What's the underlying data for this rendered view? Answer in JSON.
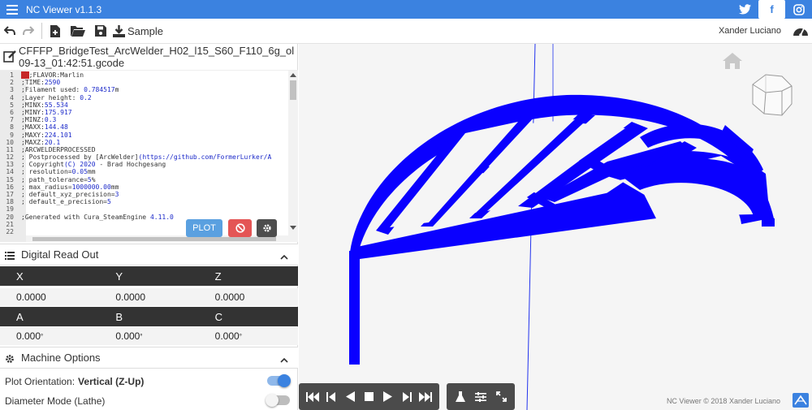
{
  "app": {
    "title": "NC Viewer  v1.1.3"
  },
  "social": {
    "twitter": "twitter-icon",
    "facebook": "facebook-icon",
    "instagram": "instagram-icon"
  },
  "toolbar": {
    "sample_label": "Sample",
    "user_name": "Xander Luciano"
  },
  "file": {
    "name_line1": "CFFFP_BridgeTest_ArcWelder_H02_l15_S60_F110_6g_ol",
    "name_line2": "09-13_01:42:51.gcode"
  },
  "editor": {
    "lines": [
      {
        "n": "1",
        "pre": "",
        "cursor": "  ",
        "text": ";FLAVOR:Marlin",
        "num": "",
        "post": ""
      },
      {
        "n": "2",
        "pre": ";TIME:",
        "num": "2590",
        "post": ""
      },
      {
        "n": "3",
        "pre": ";Filament used: ",
        "num": "0.784517",
        "post": "m"
      },
      {
        "n": "4",
        "pre": ";Layer height: ",
        "num": "0.2",
        "post": ""
      },
      {
        "n": "5",
        "pre": ";MINX:",
        "num": "55.534",
        "post": ""
      },
      {
        "n": "6",
        "pre": ";MINY:",
        "num": "175.917",
        "post": ""
      },
      {
        "n": "7",
        "pre": ";MINZ:",
        "num": "0.3",
        "post": ""
      },
      {
        "n": "8",
        "pre": ";MAXX:",
        "num": "144.48",
        "post": ""
      },
      {
        "n": "9",
        "pre": ";MAXY:",
        "num": "224.101",
        "post": ""
      },
      {
        "n": "10",
        "pre": ";MAXZ:",
        "num": "20.1",
        "post": ""
      },
      {
        "n": "11",
        "pre": ";ARCWELDERPROCESSED",
        "num": "",
        "post": ""
      },
      {
        "n": "12",
        "pre": "; Postprocessed by [ArcWelder]",
        "num": "(https://github.com/FormerLurker/A",
        "post": ""
      },
      {
        "n": "13",
        "pre": "; Copyright",
        "num": "(C) 2020",
        "post": " - Brad Hochgesang"
      },
      {
        "n": "14",
        "pre": "; resolution=",
        "num": "0.05",
        "post": "mm"
      },
      {
        "n": "15",
        "pre": "; path_tolerance=",
        "num": "5",
        "post": "%"
      },
      {
        "n": "16",
        "pre": "; max_radius=",
        "num": "1000000.00",
        "post": "mm"
      },
      {
        "n": "17",
        "pre": "; default_xyz_precision=",
        "num": "3",
        "post": ""
      },
      {
        "n": "18",
        "pre": "; default_e_precision=",
        "num": "5",
        "post": ""
      },
      {
        "n": "19",
        "pre": "",
        "num": "",
        "post": ""
      },
      {
        "n": "20",
        "pre": ";Generated with Cura_SteamEngine ",
        "num": "4.11.0",
        "post": ""
      },
      {
        "n": "21",
        "pre": "",
        "num": "",
        "post": ""
      },
      {
        "n": "22",
        "pre": "",
        "num": "",
        "post": ""
      }
    ],
    "plot_label": "PLOT"
  },
  "dro": {
    "title": "Digital Read Out",
    "headers1": [
      "X",
      "Y",
      "Z"
    ],
    "values1": [
      "0.0000",
      "0.0000",
      "0.0000"
    ],
    "headers2": [
      "A",
      "B",
      "C"
    ],
    "values2": [
      "0.000",
      "0.000",
      "0.000"
    ],
    "degree": "°"
  },
  "machine": {
    "title": "Machine Options",
    "plot_orientation_label": "Plot Orientation:",
    "plot_orientation_value": "Vertical (Z-Up)",
    "plot_orientation_on": true,
    "diameter_label": "Diameter Mode (Lathe)",
    "diameter_on": false
  },
  "viewer": {
    "footer": "NC Viewer © 2018 Xander Luciano"
  },
  "colors": {
    "accent": "#3b82e0",
    "toolpath": "#0000ff",
    "dark": "#333333"
  }
}
